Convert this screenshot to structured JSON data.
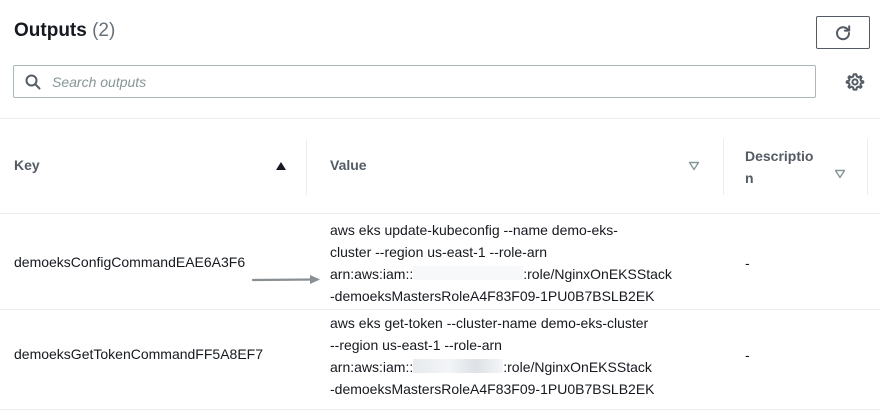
{
  "header": {
    "title": "Outputs",
    "count": "(2)"
  },
  "search": {
    "placeholder": "Search outputs",
    "value": ""
  },
  "icons": {
    "refresh": "refresh-icon",
    "search": "search-icon",
    "settings": "gear-icon",
    "sort_ascending": "caret-up-icon",
    "sort_default": "caret-down-outline-icon"
  },
  "table": {
    "columns": [
      {
        "label": "Key",
        "sort": "ascending"
      },
      {
        "label": "Value",
        "sort": "none"
      },
      {
        "label_line1": "Descriptio",
        "label_line2": "n",
        "sort": "none"
      }
    ],
    "rows": [
      {
        "key": "demoeksConfigCommandEAE6A3F6",
        "value_lines": [
          "aws eks update-kubeconfig --name demo-eks-",
          "cluster --region us-east-1 --role-arn",
          "arn:aws:iam::",
          ":role/NginxOnEKSStack",
          "-demoeksMastersRoleA4F83F09-1PU0B7BSLB2EK"
        ],
        "description": "-"
      },
      {
        "key": "demoeksGetTokenCommandFF5A8EF7",
        "value_lines": [
          "aws eks get-token --cluster-name demo-eks-cluster",
          "--region us-east-1 --role-arn",
          "arn:aws:iam::",
          ":role/NginxOnEKSStack",
          "-demoeksMastersRoleA4F83F09-1PU0B7BSLB2EK"
        ],
        "description": "-"
      }
    ]
  },
  "colors": {
    "text": "#16191f",
    "muted": "#687078",
    "border": "#eaeded",
    "input_border": "#aab7b8",
    "arrow": "#8a8f94"
  }
}
